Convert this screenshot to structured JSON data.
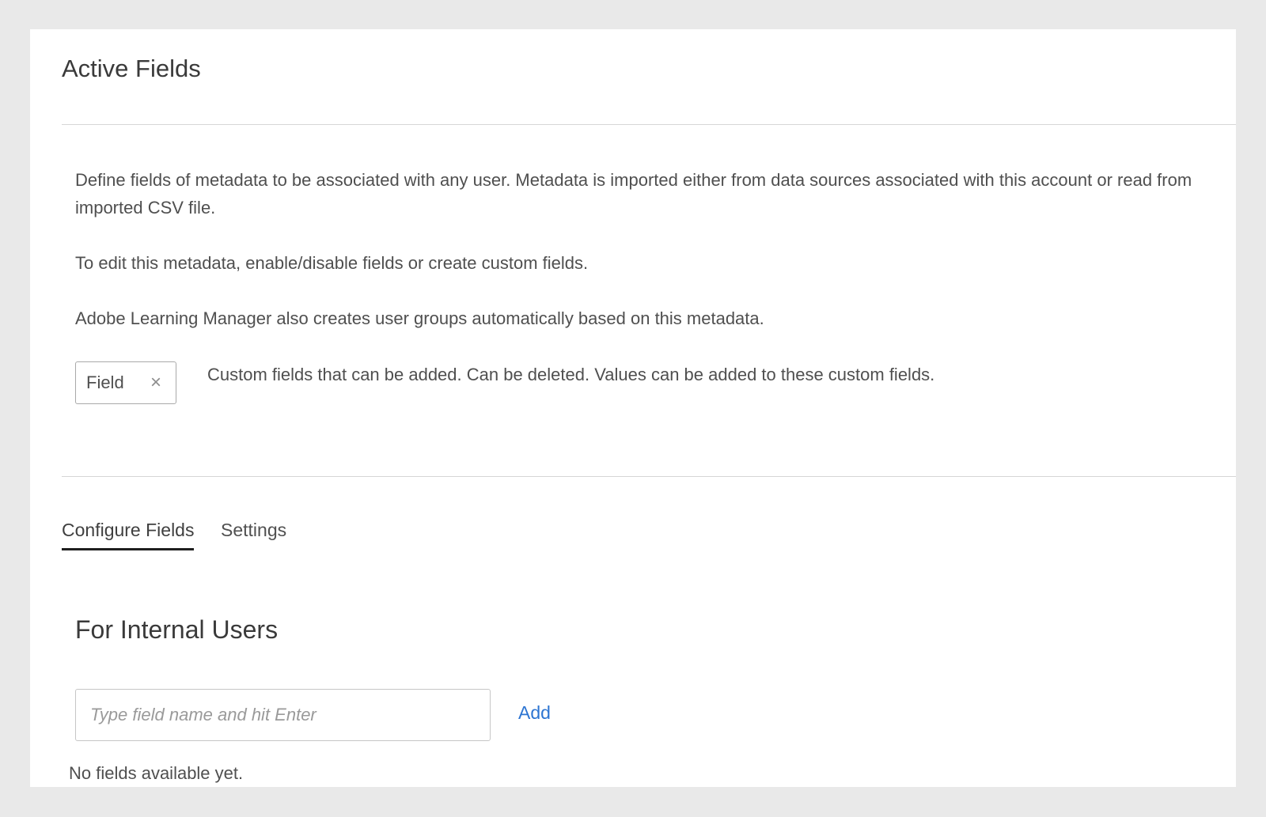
{
  "page": {
    "title": "Active Fields"
  },
  "description": {
    "line1": "Define fields of metadata to be associated with any user. Metadata is imported either from data sources associated with this account or read from",
    "line2": "imported CSV file.",
    "para2": "To edit this metadata, enable/disable fields or create custom fields.",
    "para3": "Adobe Learning Manager also creates user groups automatically based on this metadata."
  },
  "legend": {
    "chip_label": "Field",
    "chip_icon": "close-icon",
    "note": "Custom fields that can be added. Can be deleted. Values can be added to these custom fields."
  },
  "tabs": [
    {
      "label": "Configure Fields",
      "active": true
    },
    {
      "label": "Settings",
      "active": false
    }
  ],
  "internal_users": {
    "title": "For Internal Users",
    "input_placeholder": "Type field name and hit Enter",
    "input_value": "",
    "add_label": "Add",
    "empty_message": "No fields available yet."
  },
  "colors": {
    "background": "#e9e9e9",
    "panel": "#ffffff",
    "link": "#2d75d2",
    "active_tab_underline": "#1f1f1f"
  }
}
